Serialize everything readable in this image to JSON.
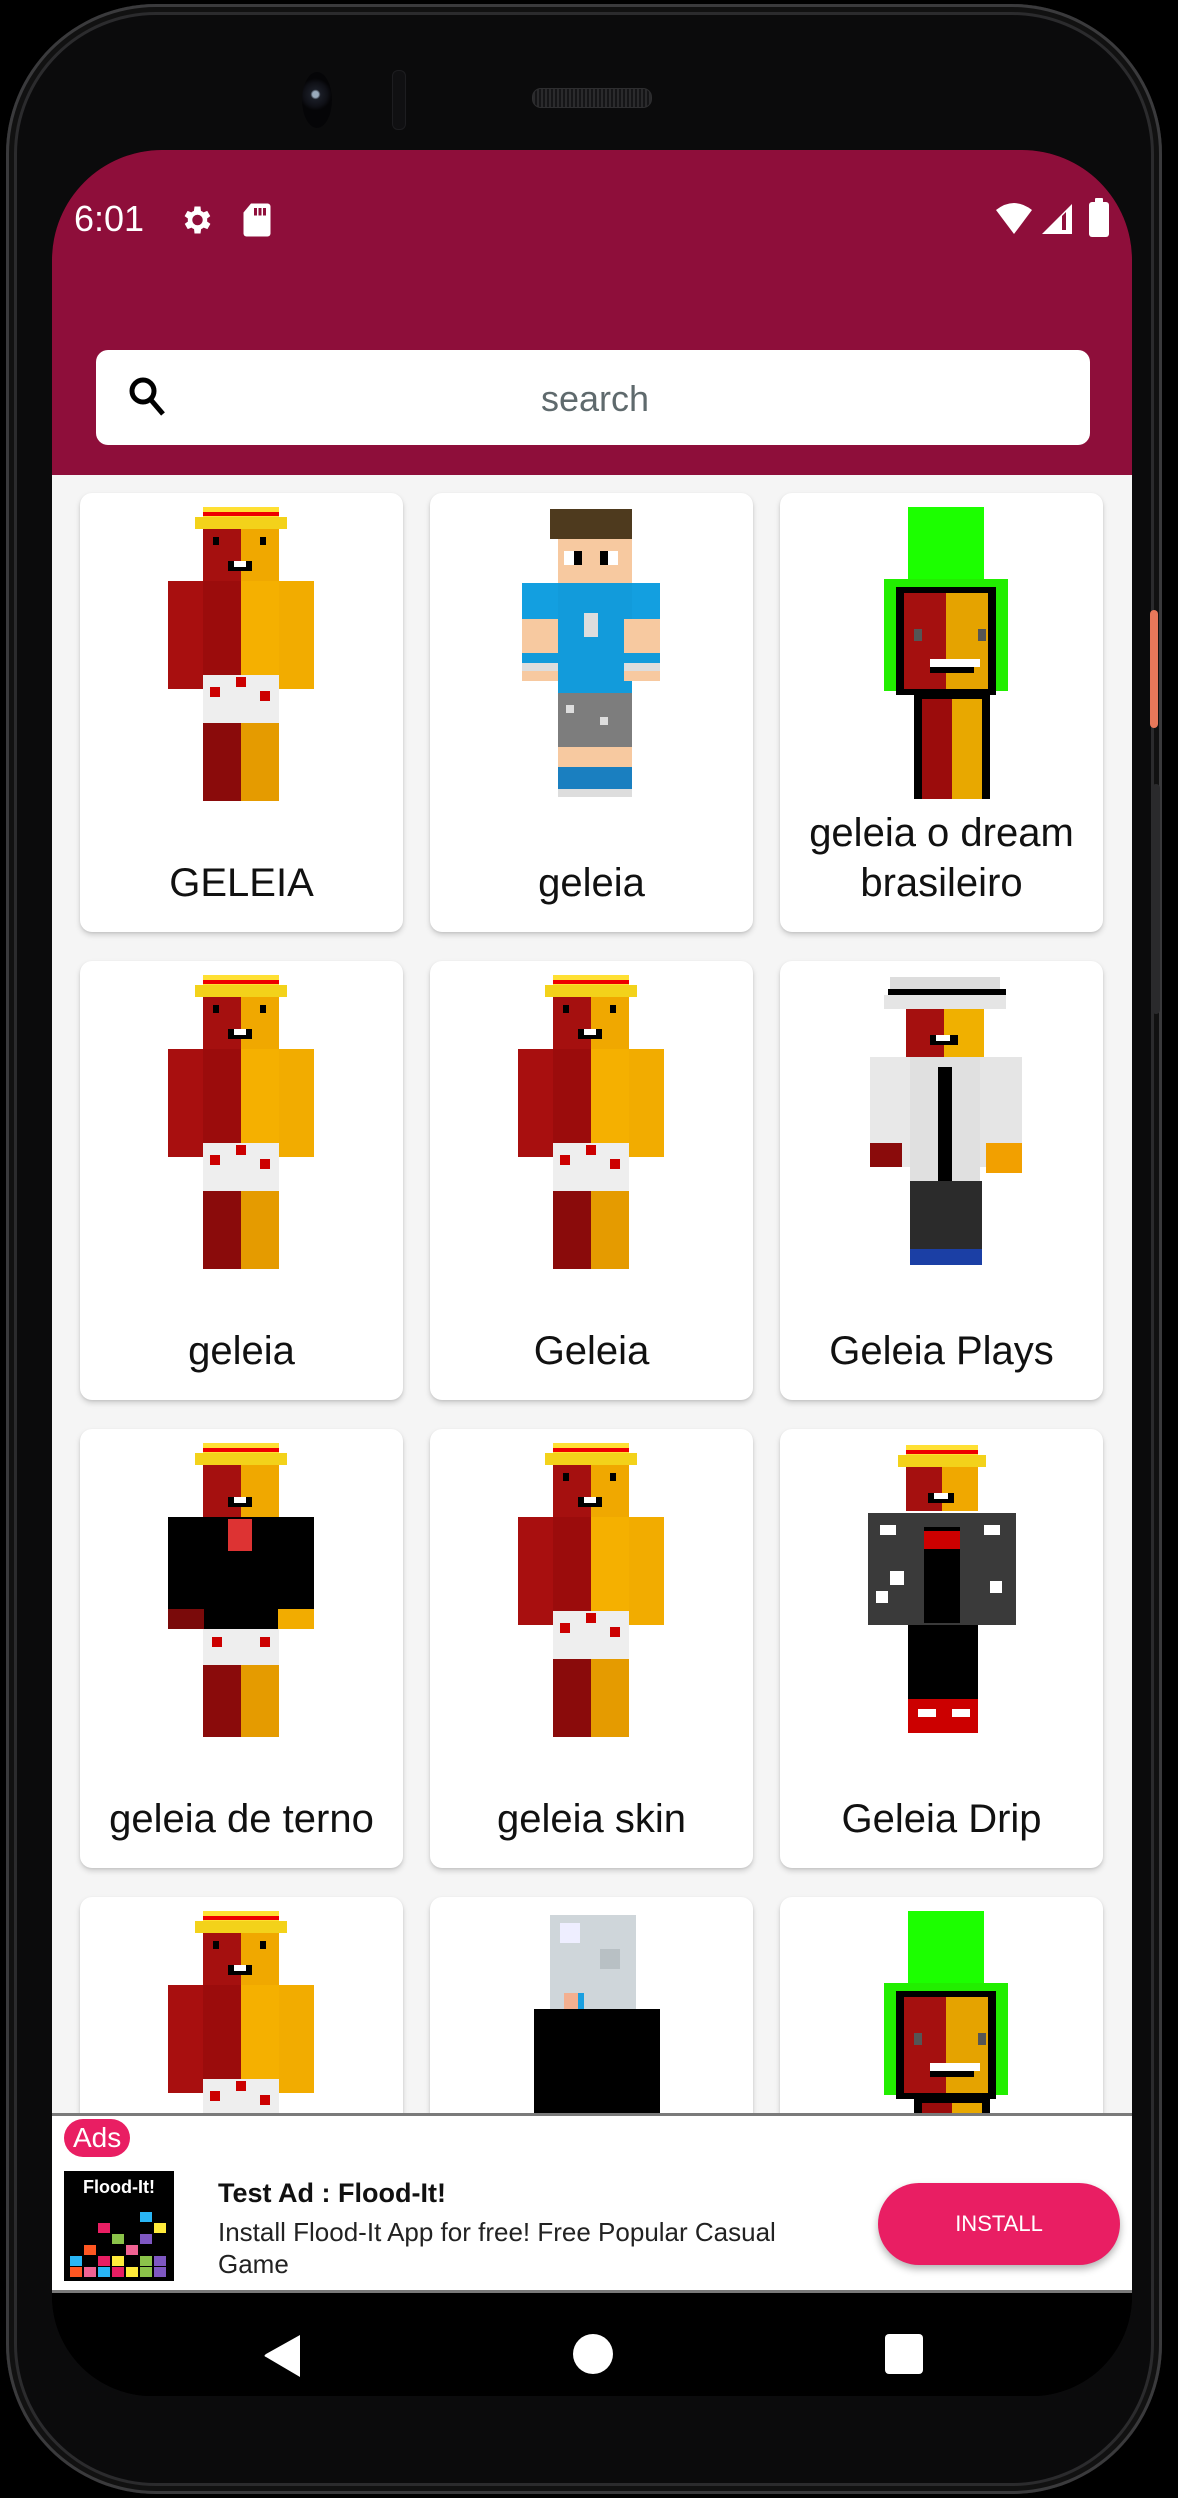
{
  "status_bar": {
    "time": "6:01",
    "left_icons": [
      "gear-icon",
      "sd-card-icon"
    ],
    "right_icons": [
      "wifi-icon",
      "cell-signal-icon",
      "battery-icon"
    ]
  },
  "colors": {
    "app_bar": "#8e0e3a",
    "accent": "#e91e63",
    "background": "#f5f5f5"
  },
  "search": {
    "placeholder": "search",
    "value": "",
    "icon": "search-icon"
  },
  "skins": [
    {
      "label": "GELEIA",
      "style": "geleia-shorts"
    },
    {
      "label": "geleia",
      "style": "blue-shirt-boy"
    },
    {
      "label": "geleia o dream brasileiro",
      "style": "dream-green"
    },
    {
      "label": "geleia",
      "style": "geleia-shorts"
    },
    {
      "label": "Geleia",
      "style": "geleia-shorts"
    },
    {
      "label": "Geleia Plays",
      "style": "white-jacket"
    },
    {
      "label": "geleia de terno",
      "style": "geleia-suit"
    },
    {
      "label": "geleia skin",
      "style": "geleia-shorts"
    },
    {
      "label": "Geleia Drip",
      "style": "geleia-drip"
    },
    {
      "label": "",
      "style": "geleia-shorts"
    },
    {
      "label": "",
      "style": "white-hair"
    },
    {
      "label": "",
      "style": "dream-green"
    }
  ],
  "ad": {
    "badge": "Ads",
    "logo_text": "Flood-It!",
    "title": "Test Ad : Flood-It!",
    "description": "Install Flood-It App for free! Free Popular Casual Game",
    "cta": "INSTALL"
  },
  "nav": {
    "back": "back-icon",
    "home": "home-icon",
    "recents": "recents-icon"
  }
}
